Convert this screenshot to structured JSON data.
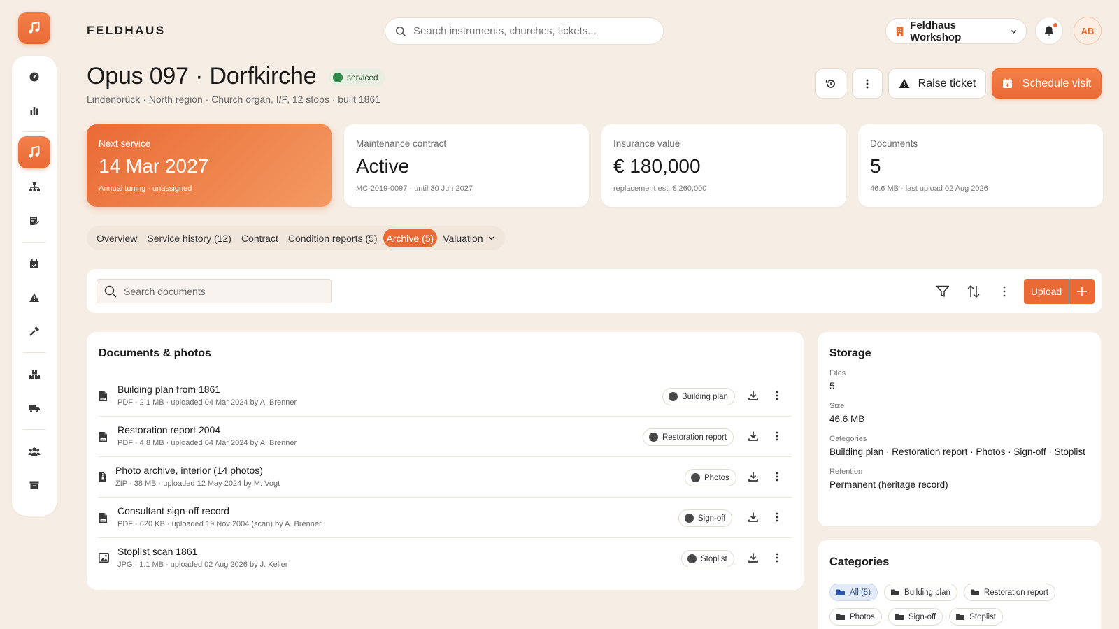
{
  "brand": {
    "wordmark": "FELDHAUS",
    "logo_icon": "music-note-icon"
  },
  "topbar": {
    "search_placeholder": "Search instruments, churches, tickets...",
    "workspace": "Feldhaus Workshop",
    "avatar_initials": "AB"
  },
  "rail": {
    "items": [
      "dashboard-icon",
      "chart-icon",
      "instruments-icon",
      "org-icon",
      "reports-icon",
      "calendar-icon",
      "alert-icon",
      "tools-icon",
      "inventory-icon",
      "truck-icon",
      "people-icon",
      "archive-icon"
    ],
    "active": "instruments-icon"
  },
  "header": {
    "title": "Opus 097 · Dorfkirche",
    "status": "serviced",
    "subtitle": "Lindenbrück · North region · Church organ, I/P, 12 stops · built 1861",
    "raise_ticket": "Raise ticket",
    "schedule_visit": "Schedule visit"
  },
  "stats": [
    {
      "label": "Next service",
      "value": "14 Mar 2027",
      "note": "Annual tuning · unassigned"
    },
    {
      "label": "Maintenance contract",
      "value": "Active",
      "note": "MC-2019-0097 · until 30 Jun 2027"
    },
    {
      "label": "Insurance value",
      "value": "€ 180,000",
      "note": "replacement est. € 260,000"
    },
    {
      "label": "Documents",
      "value": "5",
      "note": "46.6 MB · last upload 02 Aug 2026"
    }
  ],
  "tabs": [
    "Overview",
    "Service history (12)",
    "Contract",
    "Condition reports (5)",
    "Archive (5)",
    "Valuation"
  ],
  "active_tab": "Archive (5)",
  "toolbar": {
    "search_placeholder": "Search documents",
    "upload": "Upload"
  },
  "documents": {
    "title": "Documents & photos",
    "rows": [
      {
        "name": "Building plan from 1861",
        "meta": "PDF · 2.1 MB · uploaded 04 Mar 2024 by A. Brenner",
        "tag": "Building plan",
        "icon": "pdf-file-icon"
      },
      {
        "name": "Restoration report 2004",
        "meta": "PDF · 4.8 MB · uploaded 04 Mar 2024 by A. Brenner",
        "tag": "Restoration report",
        "icon": "pdf-file-icon"
      },
      {
        "name": "Photo archive, interior (14 photos)",
        "meta": "ZIP · 38 MB · uploaded 12 May 2024 by M. Vogt",
        "tag": "Photos",
        "icon": "zip-file-icon"
      },
      {
        "name": "Consultant sign-off record",
        "meta": "PDF · 620 KB · uploaded 19 Nov 2004 (scan) by A. Brenner",
        "tag": "Sign-off",
        "icon": "pdf-file-icon"
      },
      {
        "name": "Stoplist scan 1861",
        "meta": "JPG · 1.1 MB · uploaded 02 Aug 2026 by J. Keller",
        "tag": "Stoplist",
        "icon": "image-file-icon"
      }
    ]
  },
  "storage": {
    "title": "Storage",
    "items": [
      {
        "label": "Files",
        "value": "5"
      },
      {
        "label": "Size",
        "value": "46.6 MB"
      },
      {
        "label": "Categories",
        "value": "Building plan · Restoration report · Photos · Sign-off · Stoplist"
      },
      {
        "label": "Retention",
        "value": "Permanent (heritage record)"
      }
    ]
  },
  "categories": {
    "title": "Categories",
    "chips": [
      "All (5)",
      "Building plan",
      "Restoration report",
      "Photos",
      "Sign-off",
      "Stoplist"
    ],
    "active": "All (5)"
  },
  "colors": {
    "accent": "#ea6a35",
    "background": "#f6ede4",
    "status_green": "#2f8a4a",
    "chip_active": "#e4ebf8"
  }
}
